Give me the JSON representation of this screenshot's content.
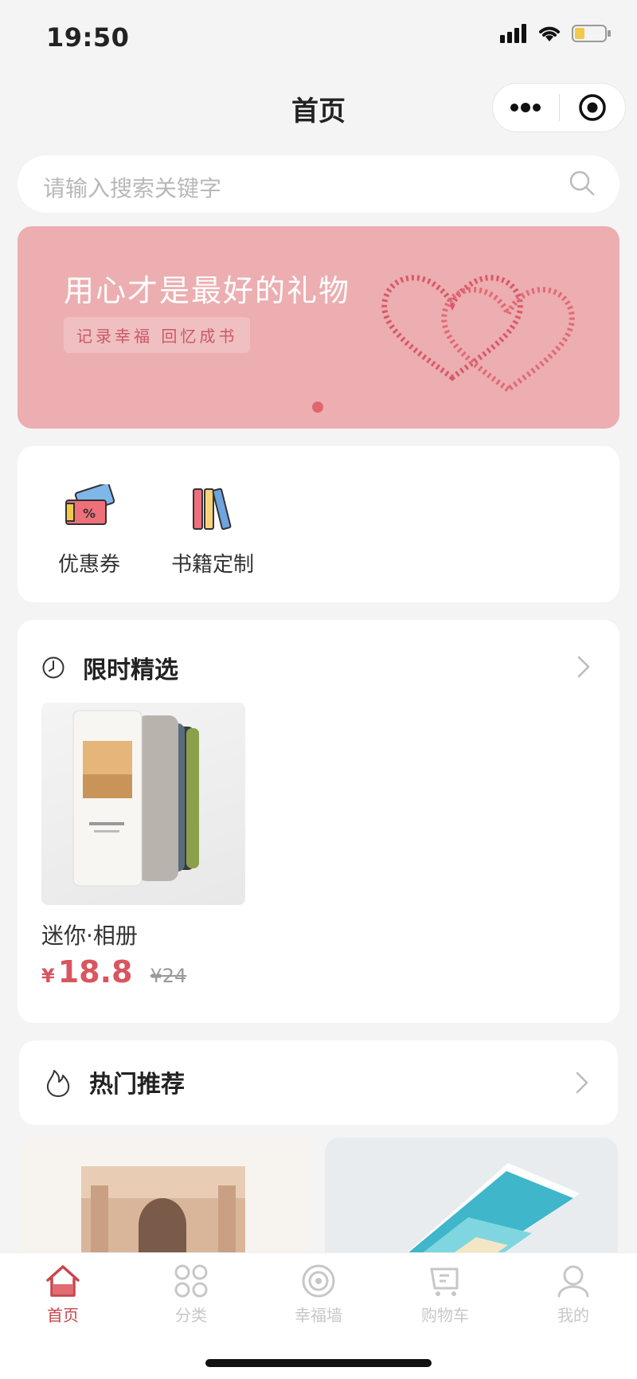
{
  "status_bar": {
    "time": "19:50"
  },
  "nav": {
    "title": "首页"
  },
  "search": {
    "placeholder": "请输入搜索关键字"
  },
  "banner": {
    "title": "用心才是最好的礼物",
    "subtitle": "记录幸福 回忆成书"
  },
  "quick_entries": [
    {
      "label": "优惠券",
      "icon": "coupon-icon"
    },
    {
      "label": "书籍定制",
      "icon": "books-icon"
    }
  ],
  "flash_sale": {
    "title": "限时精选",
    "product": {
      "name": "迷你·相册",
      "currency": "¥",
      "price": "18.8",
      "original_price": "¥24"
    }
  },
  "hot": {
    "title": "热门推荐"
  },
  "tabbar": [
    {
      "label": "首页",
      "icon": "home-icon",
      "active": true
    },
    {
      "label": "分类",
      "icon": "category-icon",
      "active": false
    },
    {
      "label": "幸福墙",
      "icon": "wall-icon",
      "active": false
    },
    {
      "label": "购物车",
      "icon": "cart-icon",
      "active": false
    },
    {
      "label": "我的",
      "icon": "profile-icon",
      "active": false
    }
  ],
  "colors": {
    "accent": "#d9555f",
    "banner_bg": "#ecaeb0",
    "active_tab": "#c8454c"
  }
}
